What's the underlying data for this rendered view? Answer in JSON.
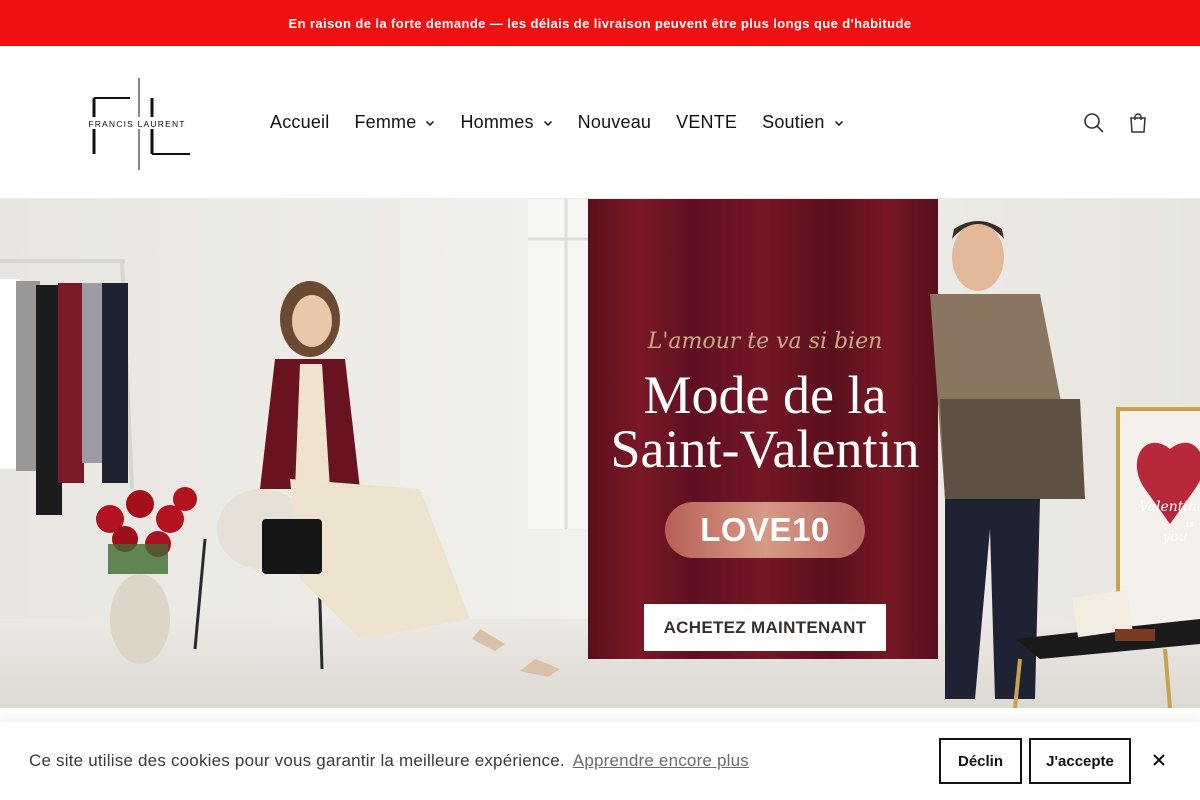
{
  "announcement": {
    "text": "En raison de la forte demande — les délais de livraison peuvent être plus longs que d'habitude"
  },
  "brand": {
    "monogram": "FL",
    "name": "FRANCIS LAURENT"
  },
  "nav": {
    "items": [
      {
        "label": "Accueil",
        "has_dropdown": false
      },
      {
        "label": "Femme",
        "has_dropdown": true
      },
      {
        "label": "Hommes",
        "has_dropdown": true
      },
      {
        "label": "Nouveau",
        "has_dropdown": false
      },
      {
        "label": "VENTE",
        "has_dropdown": false
      },
      {
        "label": "Soutien",
        "has_dropdown": true
      }
    ]
  },
  "header_icons": [
    "search-icon",
    "cart-icon"
  ],
  "hero": {
    "eyebrow": "L'amour te va si bien",
    "title_line1": "Mode de la",
    "title_line2": "Saint-Valentin",
    "promo_code": "LOVE10",
    "cta": "ACHETEZ MAINTENANT",
    "card_text_1": "Valentine",
    "card_text_2": "is",
    "card_text_3": "you"
  },
  "cookie": {
    "message": "Ce site utilise des cookies pour vous garantir la meilleure expérience.",
    "learn_more": "Apprendre encore plus",
    "decline": "Déclin",
    "accept": "J'accepte"
  },
  "colors": {
    "announcement_bg": "#ef1111",
    "curtain": "#6e1422",
    "promo_pill": "#c97a6e",
    "accent_gold": "#c9a98a"
  }
}
